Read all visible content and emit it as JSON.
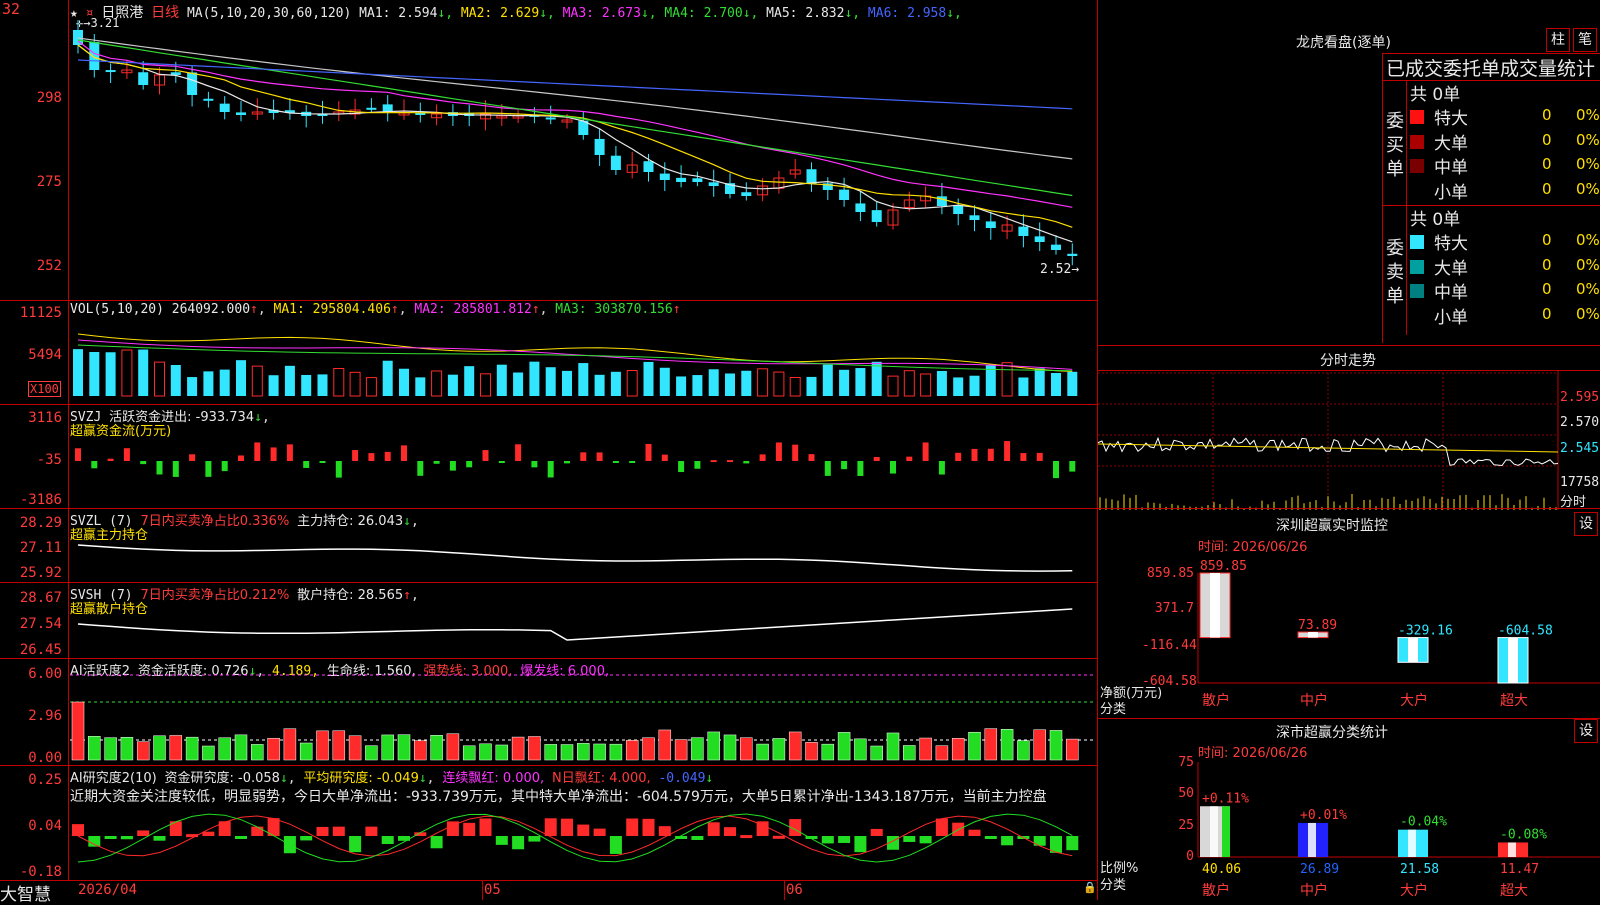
{
  "header": {
    "stock_name": "日照港",
    "period": "日线",
    "ma_label": "MA(5,10,20,30,60,120)",
    "ma_values": [
      {
        "label": "MA1:",
        "value": "2.594",
        "arrow": "↓",
        "color": "#e8e8e8"
      },
      {
        "label": "MA2:",
        "value": "2.629",
        "arrow": "↓",
        "color": "#ffe000"
      },
      {
        "label": "MA3:",
        "value": "2.673",
        "arrow": "↓",
        "color": "#ff33ff"
      },
      {
        "label": "MA4:",
        "value": "2.700",
        "arrow": "↓",
        "color": "#33dd33"
      },
      {
        "label": "MA5:",
        "value": "2.832",
        "arrow": "↓",
        "color": "#e8e8e8"
      },
      {
        "label": "MA6:",
        "value": "2.958",
        "arrow": "↓",
        "color": "#4466ff"
      }
    ],
    "high_mark": "3.21",
    "last_price": "2.52",
    "top_tick_partial": "32"
  },
  "price_axis": [
    "298",
    "275",
    "252"
  ],
  "vol_panel": {
    "label": "VOL(5,10,20)",
    "value": "264092.000",
    "ma1": "MA1: 295804.406",
    "ma2": "MA2: 285801.812",
    "ma3": "MA3: 303870.156",
    "axis": [
      "11125",
      "5494"
    ],
    "unit": "X100"
  },
  "svzj_panel": {
    "label": "SVZJ",
    "desc": "活跃资金进出: -933.734",
    "sub": "超赢资金流(万元)",
    "axis": [
      "3116",
      "-35",
      "-3186"
    ]
  },
  "svzl_panel": {
    "label": "SVZL (7)",
    "desc1": "7日内买卖净占比0.336%",
    "desc2": "主力持仓: 26.043",
    "sub": "超赢主力持仓",
    "axis": [
      "28.29",
      "27.11",
      "25.92"
    ]
  },
  "svsh_panel": {
    "label": "SVSH (7)",
    "desc1": "7日内买卖净占比0.212%",
    "desc2": "散户持仓: 28.565",
    "sub": "超赢散户持仓",
    "axis": [
      "28.67",
      "27.54",
      "26.45"
    ]
  },
  "ai1_panel": {
    "label": "AI活跃度2",
    "d1": "资金活跃度: 0.726",
    "d2": "4.189,",
    "d3": "生命线: 1.560,",
    "d4": "强势线: 3.000,",
    "d5": "爆发线: 6.000,",
    "axis": [
      "6.00",
      "2.96",
      "0.00"
    ]
  },
  "ai2_panel": {
    "label": "AI研究度2(10)",
    "d1": "资金研究度: -0.058",
    "d2": "平均研究度: -0.049",
    "d3": "连续飘红: 0.000,",
    "d4": "N日飘红: 4.000,",
    "d5": "-0.049",
    "summary": "近期大资金关注度较低，明显弱势，今日大单净流出：-933.739万元，其中特大单净流出：-604.579万元，大单5日累计净出-1343.187万元，当前主力控盘",
    "axis": [
      "0.25",
      "0.04",
      "-0.18"
    ]
  },
  "bottom": {
    "brand": "大智慧",
    "dates": [
      "2026/04",
      "05",
      "06"
    ]
  },
  "dragon": {
    "title": "龙虎看盘(逐单)",
    "btn1": "柱",
    "btn2": "笔",
    "subtitle": "已成交委托单成交量统计",
    "buy_label": "委买单",
    "sell_label": "委卖单",
    "buy_total": "共 0单",
    "sell_total": "共 0单",
    "rows": [
      {
        "name": "特大",
        "count": "0",
        "pct": "0%"
      },
      {
        "name": "大单",
        "count": "0",
        "pct": "0%"
      },
      {
        "name": "中单",
        "count": "0",
        "pct": "0%"
      },
      {
        "name": "小单",
        "count": "0",
        "pct": "0%"
      }
    ]
  },
  "intraday": {
    "title": "分时走势",
    "axis": [
      "2.595",
      "2.570",
      "2.545",
      "17758"
    ],
    "unit": "分时"
  },
  "realtime": {
    "title": "深圳超赢实时监控",
    "set": "设",
    "time": "时间: 2026/06/26",
    "axis": [
      "859.85",
      "371.7",
      "-116.44",
      "-604.58"
    ],
    "ylabel": "净额(万元)",
    "xlabel": "分类",
    "categories": [
      "散户",
      "中户",
      "大户",
      "超大"
    ],
    "values": [
      "859.85",
      "73.89",
      "-329.16",
      "-604.58"
    ]
  },
  "classify": {
    "title": "深市超赢分类统计",
    "set": "设",
    "time": "时间: 2026/06/26",
    "axis": [
      "75",
      "50",
      "25",
      "0"
    ],
    "ylabel": "比例%",
    "xlabel": "分类",
    "categories": [
      "散户",
      "中户",
      "大户",
      "超大"
    ],
    "values": [
      "40.06",
      "26.89",
      "21.58",
      "11.47"
    ],
    "changes": [
      "+0.11%",
      "+0.01%",
      "-0.04%",
      "-0.08%"
    ]
  },
  "chart_data": [
    {
      "type": "bar",
      "title": "深圳超赢实时监控",
      "categories": [
        "散户",
        "中户",
        "大户",
        "超大"
      ],
      "values": [
        859.85,
        73.89,
        -329.16,
        -604.58
      ],
      "ylabel": "净额(万元)",
      "ylim": [
        -604.58,
        859.85
      ]
    },
    {
      "type": "bar",
      "title": "深市超赢分类统计",
      "categories": [
        "散户",
        "中户",
        "大户",
        "超大"
      ],
      "values": [
        40.06,
        26.89,
        21.58,
        11.47
      ],
      "ylabel": "比例%",
      "ylim": [
        0,
        75
      ]
    }
  ]
}
